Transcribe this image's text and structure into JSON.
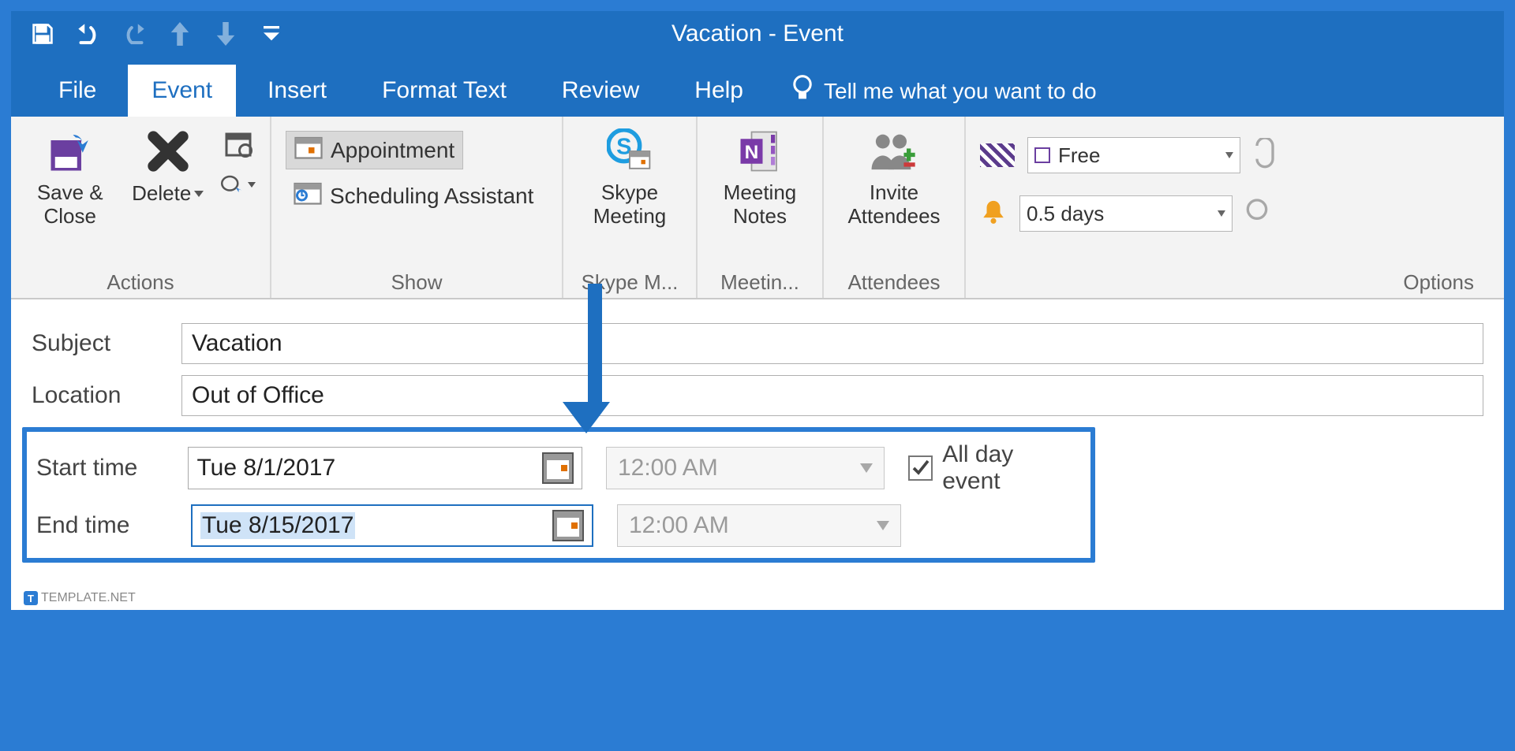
{
  "title": "Vacation  -  Event",
  "tabs": [
    "File",
    "Event",
    "Insert",
    "Format Text",
    "Review",
    "Help"
  ],
  "tell_me": "Tell me what you want to do",
  "ribbon": {
    "actions": {
      "save_close": "Save & Close",
      "delete": "Delete",
      "group_label": "Actions"
    },
    "show": {
      "appointment": "Appointment",
      "scheduling": "Scheduling Assistant",
      "group_label": "Show"
    },
    "skype": {
      "label1": "Skype",
      "label2": "Meeting",
      "group_label": "Skype M..."
    },
    "notes": {
      "label1": "Meeting",
      "label2": "Notes",
      "group_label": "Meetin..."
    },
    "attendees": {
      "label1": "Invite",
      "label2": "Attendees",
      "group_label": "Attendees"
    },
    "options": {
      "show_as": "Free",
      "reminder": "0.5 days",
      "group_label": "Options"
    }
  },
  "form": {
    "subject_label": "Subject",
    "subject_value": "Vacation",
    "location_label": "Location",
    "location_value": "Out of Office",
    "start_label": "Start time",
    "start_date": "Tue 8/1/2017",
    "start_time": "12:00 AM",
    "end_label": "End time",
    "end_date": "Tue 8/15/2017",
    "end_time": "12:00 AM",
    "all_day_label": "All day event",
    "all_day_checked": true
  },
  "watermark": "TEMPLATE.NET"
}
